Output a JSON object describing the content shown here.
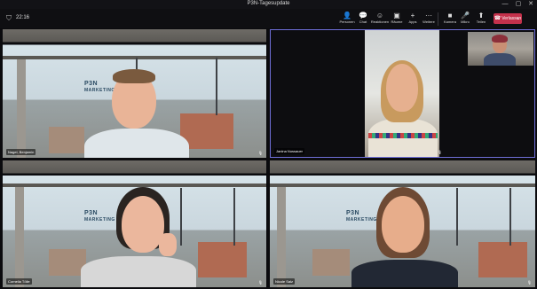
{
  "window": {
    "title": "P3N-Tagesupdate",
    "controls": [
      "—",
      "▢",
      "✕"
    ]
  },
  "toolbar": {
    "timer": "22:16",
    "items": [
      {
        "icon": "people-icon",
        "glyph": "👤",
        "label": "Personen"
      },
      {
        "icon": "chat-icon",
        "glyph": "💬",
        "label": "Chat"
      },
      {
        "icon": "reactions-icon",
        "glyph": "☺",
        "label": "Reaktionen"
      },
      {
        "icon": "rooms-icon",
        "glyph": "▣",
        "label": "Räume"
      },
      {
        "icon": "apps-icon",
        "glyph": "+",
        "label": "Apps"
      },
      {
        "icon": "more-icon",
        "glyph": "···",
        "label": "Weitere"
      },
      {
        "icon": "camera-icon",
        "glyph": "■",
        "label": "Kamera"
      },
      {
        "icon": "mic-icon",
        "glyph": "🎤",
        "label": "Mikro"
      },
      {
        "icon": "share-icon",
        "glyph": "⬆",
        "label": "Teilen"
      }
    ],
    "leave_label": "Verlassen",
    "leave_dropdown": "⌄"
  },
  "participants": [
    {
      "name": "Nagel, Benjamin",
      "shirt": "#dfe6ea",
      "hair": "#7a5a3e",
      "skin": "#e9b497"
    },
    {
      "name": "Janina Nussauer",
      "shirt": "#e9e3d6",
      "hair": "#c89a5e",
      "skin": "#e6b08f"
    },
    {
      "name": "Cornelia Tölle",
      "shirt": "#d7d7d7",
      "hair": "#2a2421",
      "skin": "#ebb79d"
    },
    {
      "name": "Nicole Salz",
      "shirt": "#222834",
      "hair": "#6e4a34",
      "skin": "#e7ad8b"
    }
  ],
  "branding": {
    "sign_line1": "P3N",
    "sign_line2": "MARKETING"
  },
  "mic_glyph": "🎙"
}
